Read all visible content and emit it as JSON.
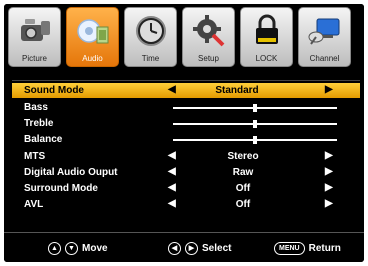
{
  "tabs": [
    {
      "label": "Picture",
      "icon": "camera-icon",
      "active": false
    },
    {
      "label": "Audio",
      "icon": "audio-icon",
      "active": true
    },
    {
      "label": "Time",
      "icon": "clock-icon",
      "active": false
    },
    {
      "label": "Setup",
      "icon": "gear-icon",
      "active": false
    },
    {
      "label": "LOCK",
      "icon": "lock-icon",
      "active": false
    },
    {
      "label": "Channel",
      "icon": "satellite-dish-icon",
      "active": false
    }
  ],
  "menu": {
    "rows": [
      {
        "name": "Sound Mode",
        "value": "Standard",
        "type": "select",
        "selected": true
      },
      {
        "name": "Bass",
        "type": "slider",
        "level": 0.5
      },
      {
        "name": "Treble",
        "type": "slider",
        "level": 0.5
      },
      {
        "name": "Balance",
        "type": "slider",
        "level": 0.5
      },
      {
        "name": "MTS",
        "value": "Stereo",
        "type": "select"
      },
      {
        "name": "Digital Audio Ouput",
        "value": "Raw",
        "type": "select"
      },
      {
        "name": "Surround Mode",
        "value": "Off",
        "type": "select"
      },
      {
        "name": "AVL",
        "value": "Off",
        "type": "select"
      }
    ]
  },
  "footer": {
    "move_label": "Move",
    "select_label": "Select",
    "menu_key": "MENU",
    "return_label": "Return"
  },
  "colors": {
    "accent": "#f39a1e",
    "selected_row": "#f2b400",
    "background": "#000000"
  }
}
